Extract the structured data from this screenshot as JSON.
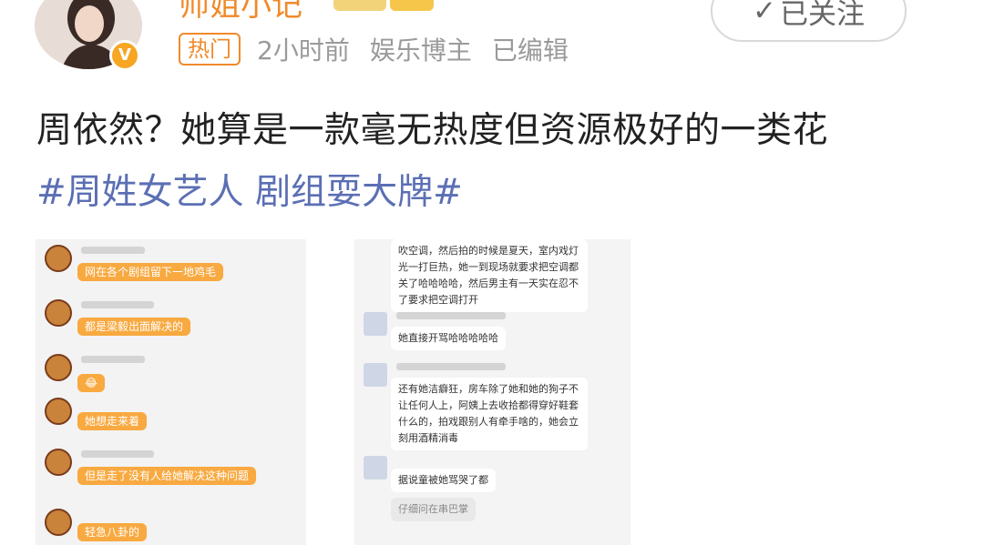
{
  "author": {
    "name": "师姐小记",
    "verified_badge": "V"
  },
  "follow_button": {
    "label": "已关注",
    "check_icon": "✓"
  },
  "meta": {
    "hot_tag": "热门",
    "time": "2小时前",
    "category": "娱乐博主",
    "edited": "已编辑"
  },
  "post": {
    "text": "周依然？她算是一款毫无热度但资源极好的一类花",
    "topic": "#周姓女艺人 剧组耍大牌#"
  },
  "left_screenshot": {
    "messages": [
      "网在各个剧组留下一地鸡毛",
      "都是梁毅出面解决的",
      "😂",
      "她想走来着",
      "但是走了没有人给她解决这种问题",
      "轻急八卦的"
    ]
  },
  "right_screenshot": {
    "top_message": "吹空调，然后拍的时候是夏天，室内戏灯光一打巨热，她一到现场就要求把空调都关了哈哈哈哈，然后男主有一天实在忍不了要求把空调打开",
    "message_2": "她直接开骂哈哈哈哈哈",
    "message_3": "还有她洁癖狂，房车除了她和她的狗子不让任何人上，阿姨上去收拾都得穿好鞋套什么的，拍戏跟别人有牵手啥的，她会立刻用酒精消毒",
    "message_4": "据说童被她骂哭了都",
    "message_5": "仔细问在串巴掌"
  }
}
